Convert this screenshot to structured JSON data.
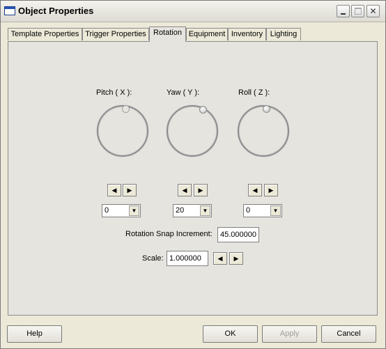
{
  "window": {
    "title": "Object Properties"
  },
  "tabs": [
    {
      "label": "Template Properties",
      "active": false
    },
    {
      "label": "Trigger Properties",
      "active": false
    },
    {
      "label": "Rotation",
      "active": true
    },
    {
      "label": "Equipment",
      "active": false
    },
    {
      "label": "Inventory",
      "active": false
    },
    {
      "label": "Lighting",
      "active": false
    }
  ],
  "rotation": {
    "pitch": {
      "label": "Pitch ( X ):",
      "value": "0"
    },
    "yaw": {
      "label": "Yaw ( Y ):",
      "value": "20"
    },
    "roll": {
      "label": "Roll ( Z ):",
      "value": "0"
    }
  },
  "snap": {
    "label": "Rotation Snap Increment:",
    "value": "45.000000"
  },
  "scale": {
    "label": "Scale:",
    "value": "1.000000"
  },
  "buttons": {
    "help": "Help",
    "ok": "OK",
    "apply": "Apply",
    "cancel": "Cancel"
  },
  "icons": {
    "left_arrow": "◀",
    "right_arrow": "▶",
    "dropdown": "▼",
    "close": "✕"
  },
  "colors": {
    "dialog_bg": "#ece9d8",
    "panel_bg": "#e6e4de",
    "disabled_text": "#a09e96"
  }
}
